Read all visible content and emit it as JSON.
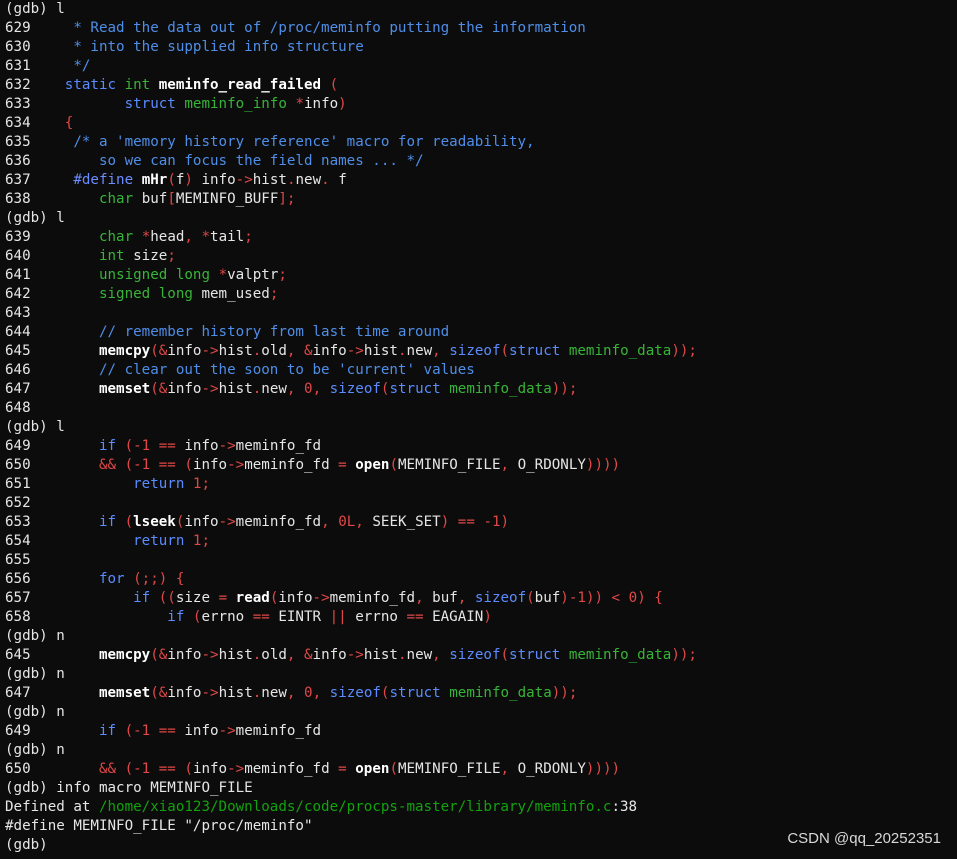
{
  "palette": {
    "background": "#0c0c0c",
    "text": "#e6e6e6",
    "keyword": "#5a8cff",
    "type": "#38b438",
    "comment": "#4f8ee8",
    "punct": "#e04848",
    "path": "#13a10e"
  },
  "lines": [
    [
      [
        "w",
        "(gdb) l"
      ]
    ],
    [
      [
        "w",
        "629     "
      ],
      [
        "c",
        "* Read the data out of /proc/meminfo putting the information"
      ]
    ],
    [
      [
        "w",
        "630     "
      ],
      [
        "c",
        "* into the supplied info structure"
      ]
    ],
    [
      [
        "w",
        "631     "
      ],
      [
        "c",
        "*/"
      ]
    ],
    [
      [
        "w",
        "632    "
      ],
      [
        "k",
        "static "
      ],
      [
        "t",
        "int "
      ],
      [
        "f",
        "meminfo_read_failed "
      ],
      [
        "p",
        "("
      ]
    ],
    [
      [
        "w",
        "633           "
      ],
      [
        "k",
        "struct "
      ],
      [
        "t",
        "meminfo_info "
      ],
      [
        "p",
        "*"
      ],
      [
        "w",
        "info"
      ],
      [
        "p",
        ")"
      ]
    ],
    [
      [
        "w",
        "634    "
      ],
      [
        "p",
        "{"
      ]
    ],
    [
      [
        "w",
        "635     "
      ],
      [
        "c",
        "/* a 'memory history reference' macro for readability,"
      ]
    ],
    [
      [
        "w",
        "636        "
      ],
      [
        "c",
        "so we can focus the field names ... */"
      ]
    ],
    [
      [
        "w",
        "637     "
      ],
      [
        "m",
        "#define "
      ],
      [
        "f",
        "mHr"
      ],
      [
        "p",
        "("
      ],
      [
        "w",
        "f"
      ],
      [
        "p",
        ") "
      ],
      [
        "w",
        "info"
      ],
      [
        "p",
        "->"
      ],
      [
        "w",
        "hist"
      ],
      [
        "p",
        "."
      ],
      [
        "w",
        "new"
      ],
      [
        "p",
        ". "
      ],
      [
        "w",
        "f"
      ]
    ],
    [
      [
        "w",
        "638        "
      ],
      [
        "t",
        "char "
      ],
      [
        "w",
        "buf"
      ],
      [
        "p",
        "["
      ],
      [
        "w",
        "MEMINFO_BUFF"
      ],
      [
        "p",
        "];"
      ]
    ],
    [
      [
        "w",
        "(gdb) l"
      ]
    ],
    [
      [
        "w",
        "639        "
      ],
      [
        "t",
        "char "
      ],
      [
        "p",
        "*"
      ],
      [
        "w",
        "head"
      ],
      [
        "p",
        ", *"
      ],
      [
        "w",
        "tail"
      ],
      [
        "p",
        ";"
      ]
    ],
    [
      [
        "w",
        "640        "
      ],
      [
        "t",
        "int "
      ],
      [
        "w",
        "size"
      ],
      [
        "p",
        ";"
      ]
    ],
    [
      [
        "w",
        "641        "
      ],
      [
        "t",
        "unsigned long "
      ],
      [
        "p",
        "*"
      ],
      [
        "w",
        "valptr"
      ],
      [
        "p",
        ";"
      ]
    ],
    [
      [
        "w",
        "642        "
      ],
      [
        "t",
        "signed long "
      ],
      [
        "w",
        "mem_used"
      ],
      [
        "p",
        ";"
      ]
    ],
    [
      [
        "w",
        "643"
      ]
    ],
    [
      [
        "w",
        "644        "
      ],
      [
        "c",
        "// remember history from last time around"
      ]
    ],
    [
      [
        "w",
        "645        "
      ],
      [
        "f",
        "memcpy"
      ],
      [
        "p",
        "(&"
      ],
      [
        "w",
        "info"
      ],
      [
        "p",
        "->"
      ],
      [
        "w",
        "hist"
      ],
      [
        "p",
        "."
      ],
      [
        "w",
        "old"
      ],
      [
        "p",
        ", &"
      ],
      [
        "w",
        "info"
      ],
      [
        "p",
        "->"
      ],
      [
        "w",
        "hist"
      ],
      [
        "p",
        "."
      ],
      [
        "w",
        "new"
      ],
      [
        "p",
        ", "
      ],
      [
        "k",
        "sizeof"
      ],
      [
        "p",
        "("
      ],
      [
        "k",
        "struct "
      ],
      [
        "t",
        "meminfo_data"
      ],
      [
        "p",
        "));"
      ]
    ],
    [
      [
        "w",
        "646        "
      ],
      [
        "c",
        "// clear out the soon to be 'current' values"
      ]
    ],
    [
      [
        "w",
        "647        "
      ],
      [
        "f",
        "memset"
      ],
      [
        "p",
        "(&"
      ],
      [
        "w",
        "info"
      ],
      [
        "p",
        "->"
      ],
      [
        "w",
        "hist"
      ],
      [
        "p",
        "."
      ],
      [
        "w",
        "new"
      ],
      [
        "p",
        ", "
      ],
      [
        "n",
        "0"
      ],
      [
        "p",
        ", "
      ],
      [
        "k",
        "sizeof"
      ],
      [
        "p",
        "("
      ],
      [
        "k",
        "struct "
      ],
      [
        "t",
        "meminfo_data"
      ],
      [
        "p",
        "));"
      ]
    ],
    [
      [
        "w",
        "648"
      ]
    ],
    [
      [
        "w",
        "(gdb) l"
      ]
    ],
    [
      [
        "w",
        "649        "
      ],
      [
        "k",
        "if "
      ],
      [
        "p",
        "("
      ],
      [
        "n",
        "-1 "
      ],
      [
        "p",
        "== "
      ],
      [
        "w",
        "info"
      ],
      [
        "p",
        "->"
      ],
      [
        "w",
        "meminfo_fd"
      ]
    ],
    [
      [
        "w",
        "650        "
      ],
      [
        "p",
        "&& ("
      ],
      [
        "n",
        "-1 "
      ],
      [
        "p",
        "== ("
      ],
      [
        "w",
        "info"
      ],
      [
        "p",
        "->"
      ],
      [
        "w",
        "meminfo_fd "
      ],
      [
        "p",
        "= "
      ],
      [
        "f",
        "open"
      ],
      [
        "p",
        "("
      ],
      [
        "w",
        "MEMINFO_FILE"
      ],
      [
        "p",
        ", "
      ],
      [
        "w",
        "O_RDONLY"
      ],
      [
        "p",
        "))))"
      ]
    ],
    [
      [
        "w",
        "651            "
      ],
      [
        "k",
        "return "
      ],
      [
        "n",
        "1"
      ],
      [
        "p",
        ";"
      ]
    ],
    [
      [
        "w",
        "652"
      ]
    ],
    [
      [
        "w",
        "653        "
      ],
      [
        "k",
        "if "
      ],
      [
        "p",
        "("
      ],
      [
        "f",
        "lseek"
      ],
      [
        "p",
        "("
      ],
      [
        "w",
        "info"
      ],
      [
        "p",
        "->"
      ],
      [
        "w",
        "meminfo_fd"
      ],
      [
        "p",
        ", "
      ],
      [
        "n",
        "0L"
      ],
      [
        "p",
        ", "
      ],
      [
        "w",
        "SEEK_SET"
      ],
      [
        "p",
        ") == "
      ],
      [
        "n",
        "-1"
      ],
      [
        "p",
        ")"
      ]
    ],
    [
      [
        "w",
        "654            "
      ],
      [
        "k",
        "return "
      ],
      [
        "n",
        "1"
      ],
      [
        "p",
        ";"
      ]
    ],
    [
      [
        "w",
        "655"
      ]
    ],
    [
      [
        "w",
        "656        "
      ],
      [
        "k",
        "for "
      ],
      [
        "p",
        "(;;) {"
      ]
    ],
    [
      [
        "w",
        "657            "
      ],
      [
        "k",
        "if "
      ],
      [
        "p",
        "(("
      ],
      [
        "w",
        "size "
      ],
      [
        "p",
        "= "
      ],
      [
        "f",
        "read"
      ],
      [
        "p",
        "("
      ],
      [
        "w",
        "info"
      ],
      [
        "p",
        "->"
      ],
      [
        "w",
        "meminfo_fd"
      ],
      [
        "p",
        ", "
      ],
      [
        "w",
        "buf"
      ],
      [
        "p",
        ", "
      ],
      [
        "k",
        "sizeof"
      ],
      [
        "p",
        "("
      ],
      [
        "w",
        "buf"
      ],
      [
        "p",
        ")"
      ],
      [
        "n",
        "-1"
      ],
      [
        "p",
        ")) < "
      ],
      [
        "n",
        "0"
      ],
      [
        "p",
        ") {"
      ]
    ],
    [
      [
        "w",
        "658                "
      ],
      [
        "k",
        "if "
      ],
      [
        "p",
        "("
      ],
      [
        "w",
        "errno "
      ],
      [
        "p",
        "== "
      ],
      [
        "w",
        "EINTR "
      ],
      [
        "p",
        "|| "
      ],
      [
        "w",
        "errno "
      ],
      [
        "p",
        "== "
      ],
      [
        "w",
        "EAGAIN"
      ],
      [
        "p",
        ")"
      ]
    ],
    [
      [
        "w",
        "(gdb) n"
      ]
    ],
    [
      [
        "w",
        "645        "
      ],
      [
        "f",
        "memcpy"
      ],
      [
        "p",
        "(&"
      ],
      [
        "w",
        "info"
      ],
      [
        "p",
        "->"
      ],
      [
        "w",
        "hist"
      ],
      [
        "p",
        "."
      ],
      [
        "w",
        "old"
      ],
      [
        "p",
        ", &"
      ],
      [
        "w",
        "info"
      ],
      [
        "p",
        "->"
      ],
      [
        "w",
        "hist"
      ],
      [
        "p",
        "."
      ],
      [
        "w",
        "new"
      ],
      [
        "p",
        ", "
      ],
      [
        "k",
        "sizeof"
      ],
      [
        "p",
        "("
      ],
      [
        "k",
        "struct "
      ],
      [
        "t",
        "meminfo_data"
      ],
      [
        "p",
        "));"
      ]
    ],
    [
      [
        "w",
        "(gdb) n"
      ]
    ],
    [
      [
        "w",
        "647        "
      ],
      [
        "f",
        "memset"
      ],
      [
        "p",
        "(&"
      ],
      [
        "w",
        "info"
      ],
      [
        "p",
        "->"
      ],
      [
        "w",
        "hist"
      ],
      [
        "p",
        "."
      ],
      [
        "w",
        "new"
      ],
      [
        "p",
        ", "
      ],
      [
        "n",
        "0"
      ],
      [
        "p",
        ", "
      ],
      [
        "k",
        "sizeof"
      ],
      [
        "p",
        "("
      ],
      [
        "k",
        "struct "
      ],
      [
        "t",
        "meminfo_data"
      ],
      [
        "p",
        "));"
      ]
    ],
    [
      [
        "w",
        "(gdb) n"
      ]
    ],
    [
      [
        "w",
        "649        "
      ],
      [
        "k",
        "if "
      ],
      [
        "p",
        "("
      ],
      [
        "n",
        "-1 "
      ],
      [
        "p",
        "== "
      ],
      [
        "w",
        "info"
      ],
      [
        "p",
        "->"
      ],
      [
        "w",
        "meminfo_fd"
      ]
    ],
    [
      [
        "w",
        "(gdb) n"
      ]
    ],
    [
      [
        "w",
        "650        "
      ],
      [
        "p",
        "&& ("
      ],
      [
        "n",
        "-1 "
      ],
      [
        "p",
        "== ("
      ],
      [
        "w",
        "info"
      ],
      [
        "p",
        "->"
      ],
      [
        "w",
        "meminfo_fd "
      ],
      [
        "p",
        "= "
      ],
      [
        "f",
        "open"
      ],
      [
        "p",
        "("
      ],
      [
        "w",
        "MEMINFO_FILE"
      ],
      [
        "p",
        ", "
      ],
      [
        "w",
        "O_RDONLY"
      ],
      [
        "p",
        "))))"
      ]
    ],
    [
      [
        "w",
        "(gdb) info macro MEMINFO_FILE"
      ]
    ],
    [
      [
        "w",
        "Defined at "
      ],
      [
        "g",
        "/home/xiao123/Downloads/code/procps-master/library/meminfo.c"
      ],
      [
        "w",
        ":38"
      ]
    ],
    [
      [
        "w",
        "#define MEMINFO_FILE \"/proc/meminfo\""
      ]
    ],
    [
      [
        "w",
        "(gdb)"
      ]
    ]
  ],
  "watermark": "CSDN @qq_20252351"
}
